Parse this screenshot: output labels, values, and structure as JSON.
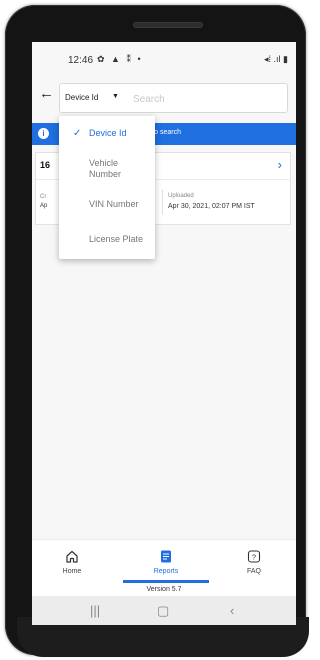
{
  "status_bar": {
    "time": "12:46",
    "notification_icons": "✿ ▲ ⁑ •",
    "system_icons": "◂⁞ .ıl ▮"
  },
  "search": {
    "type_label": "Device Id",
    "caret": "▼",
    "placeholder": "Search"
  },
  "banner": {
    "text": "aracters to search"
  },
  "card": {
    "id_prefix": "16",
    "left_label": "Cr",
    "left_value": "Ap",
    "uploaded_label": "Uploaded",
    "uploaded_value": "Apr 30, 2021, 02:07 PM IST"
  },
  "dropdown": {
    "options": [
      "Device Id",
      "Vehicle Number",
      "VIN Number",
      "License Plate"
    ],
    "selected": "Device Id"
  },
  "nav": {
    "home": "Home",
    "reports": "Reports",
    "faq": "FAQ",
    "active": "Reports"
  },
  "footer": {
    "version": "Version 5.7"
  },
  "colors": {
    "accent": "#1f6fe0",
    "frame": "#141414"
  }
}
